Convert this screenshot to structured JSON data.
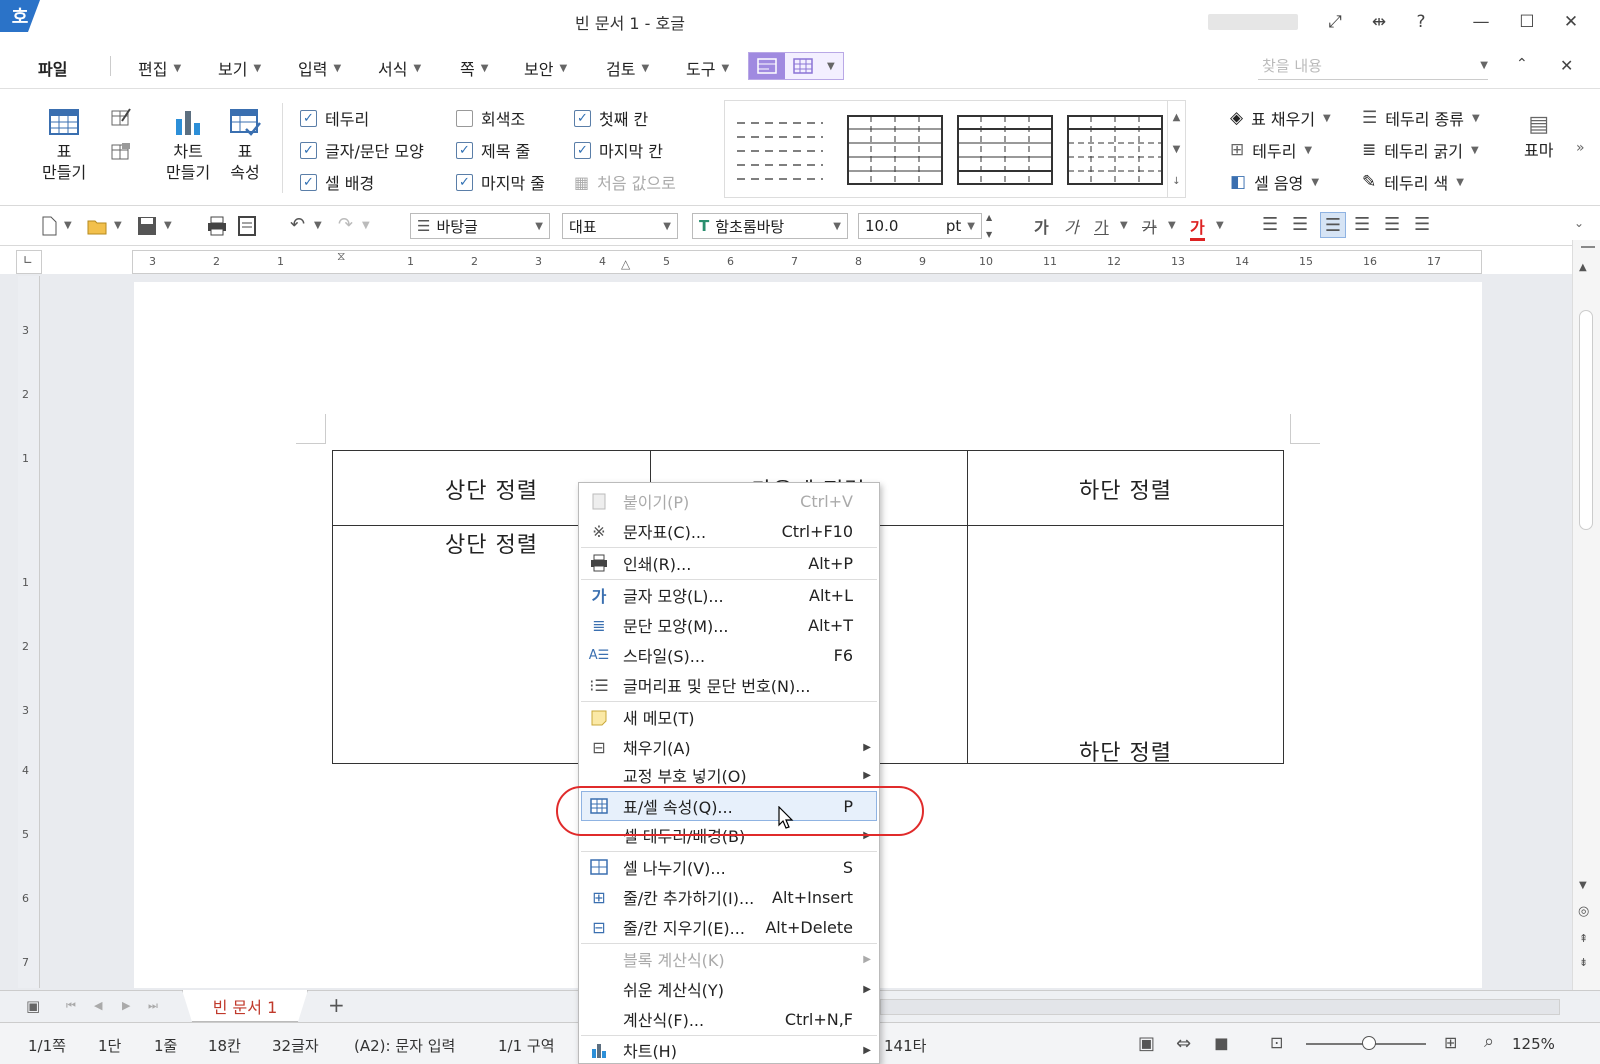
{
  "window": {
    "app_logo": "호",
    "title": "빈 문서 1 - 호글"
  },
  "menu": {
    "items": [
      "파일",
      "편집",
      "보기",
      "입력",
      "서식",
      "쪽",
      "보안",
      "검토",
      "도구"
    ],
    "search_placeholder": "찾을 내용"
  },
  "ribbon": {
    "table_create": [
      "표",
      "만들기"
    ],
    "chart_create": [
      "차트",
      "만들기"
    ],
    "table_props": [
      "표",
      "속성"
    ],
    "checks": [
      {
        "label": "테두리",
        "checked": true
      },
      {
        "label": "글자/문단 모양",
        "checked": true
      },
      {
        "label": "셀 배경",
        "checked": true
      },
      {
        "label": "회색조",
        "checked": false
      },
      {
        "label": "제목 줄",
        "checked": true
      },
      {
        "label": "마지막 줄",
        "checked": true
      },
      {
        "label": "첫째 칸",
        "checked": true
      },
      {
        "label": "마지막 칸",
        "checked": true
      }
    ],
    "reset_label": "처음 값으로",
    "fill_label": "표 채우기",
    "border_label": "테두리",
    "cell_shade_label": "셀 음영",
    "border_type_label": "테두리 종류",
    "border_width_label": "테두리 굵기",
    "border_color_label": "테두리 색",
    "table_mark_label": "표마"
  },
  "toolbar": {
    "style": "바탕글",
    "language": "대표",
    "font": "함초롬바탕",
    "font_size": "10.0",
    "unit": "pt",
    "format_glyphs": [
      "가",
      "가",
      "가",
      "가",
      "가"
    ]
  },
  "ruler": {
    "h_ticks": [
      "3",
      "2",
      "1",
      "1",
      "2",
      "3",
      "4",
      "5",
      "6",
      "7",
      "8",
      "9",
      "10",
      "11",
      "12",
      "13",
      "14",
      "15",
      "16",
      "17"
    ],
    "v_ticks": [
      "3",
      "2",
      "1",
      "1",
      "2",
      "3",
      "4",
      "5",
      "6",
      "7"
    ]
  },
  "document": {
    "cells": {
      "top_left_header": "상단 정렬",
      "top_middle_header": "가운데 정렬",
      "top_right_header": "하단 정렬",
      "body_left": "상단 정렬",
      "body_right": "하단 정렬"
    }
  },
  "context_menu": [
    {
      "label": "붙이기(P)",
      "key": "Ctrl+V",
      "disabled": true
    },
    {
      "label": "문자표(C)...",
      "key": "Ctrl+F10"
    },
    {
      "label": "인쇄(R)...",
      "key": "Alt+P"
    },
    {
      "label": "글자 모양(L)...",
      "key": "Alt+L"
    },
    {
      "label": "문단 모양(M)...",
      "key": "Alt+T"
    },
    {
      "label": "스타일(S)...",
      "key": "F6"
    },
    {
      "label": "글머리표 및 문단 번호(N)...",
      "key": ""
    },
    {
      "label": "새 메모(T)",
      "key": ""
    },
    {
      "label": "채우기(A)",
      "key": "",
      "submenu": true
    },
    {
      "label": "교정 부호 넣기(O)",
      "key": "",
      "submenu": true
    },
    {
      "label": "표/셀 속성(Q)...",
      "key": "P",
      "highlighted": true
    },
    {
      "label": "셀 테두리/배경(B)",
      "key": "",
      "submenu": true
    },
    {
      "label": "셀 나누기(V)...",
      "key": "S"
    },
    {
      "label": "줄/칸 추가하기(I)...",
      "key": "Alt+Insert"
    },
    {
      "label": "줄/칸 지우기(E)...",
      "key": "Alt+Delete"
    },
    {
      "label": "블록 계산식(K)",
      "key": "",
      "submenu": true,
      "disabled": true
    },
    {
      "label": "쉬운 계산식(Y)",
      "key": "",
      "submenu": true
    },
    {
      "label": "계산식(F)...",
      "key": "Ctrl+N,F"
    },
    {
      "label": "차트(H)",
      "key": "",
      "submenu": true
    }
  ],
  "tabs": {
    "doc_tab": "빈 문서 1",
    "add_tab": "+"
  },
  "status": {
    "page": "1/1쪽",
    "col": "1단",
    "line": "1줄",
    "char": "18칸",
    "count": "32글자",
    "mode": "(A2): 문자 입력",
    "section": "1/1 구역",
    "strokes": "141타",
    "zoom": "125%"
  },
  "colors": {
    "accent": "#2b73c8",
    "highlight_ring": "#e02b2b",
    "tab_text": "#c0392b"
  }
}
